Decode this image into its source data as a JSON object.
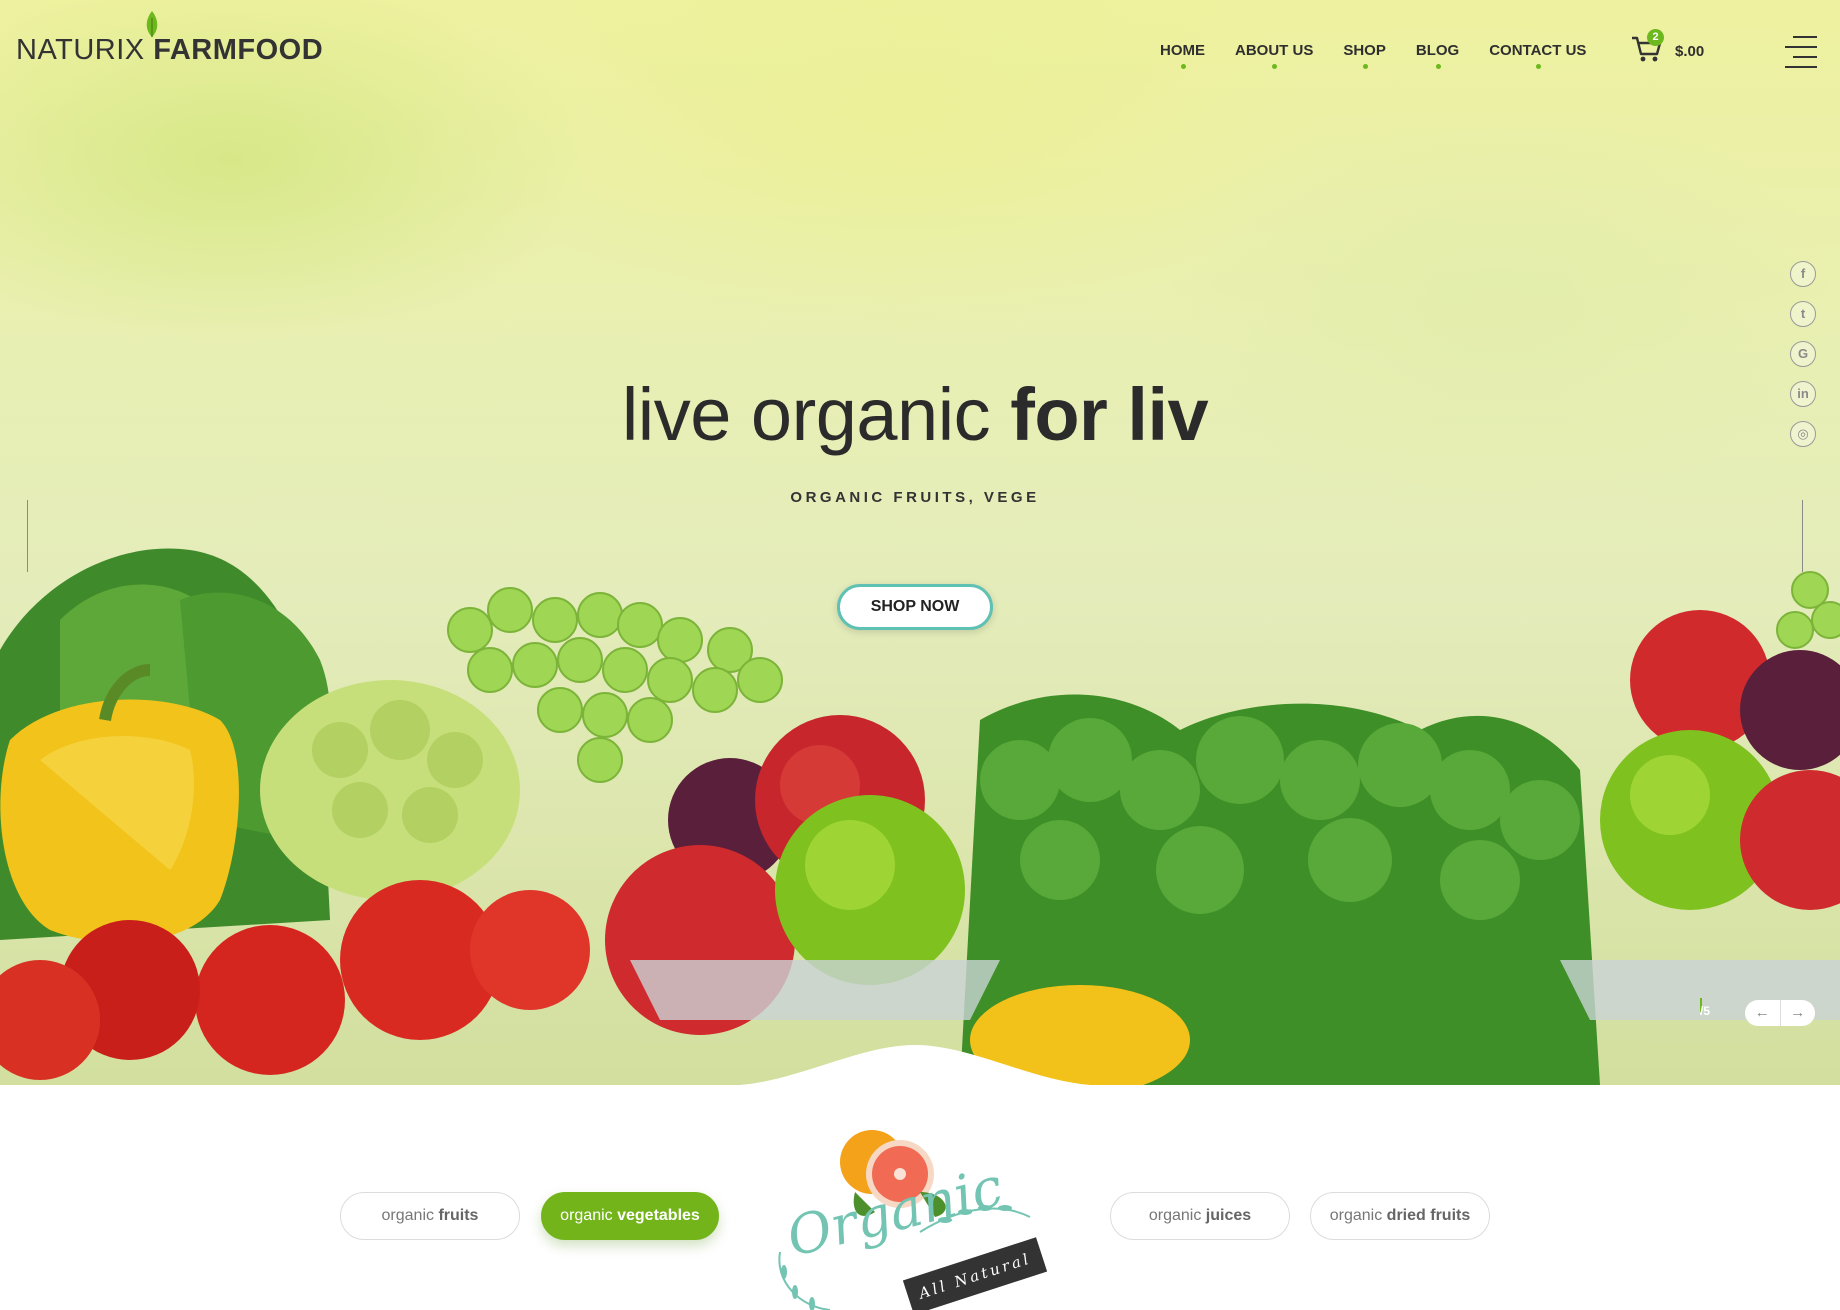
{
  "logo": {
    "light": "NATURIX",
    "bold": "FARMFOOD"
  },
  "nav": {
    "items": [
      {
        "label": "HOME"
      },
      {
        "label": "ABOUT US"
      },
      {
        "label": "SHOP"
      },
      {
        "label": "BLOG"
      },
      {
        "label": "CONTACT US"
      }
    ]
  },
  "cart": {
    "count": "2",
    "total": "$.00"
  },
  "social": [
    "facebook-icon",
    "twitter-icon",
    "google-icon",
    "linkedin-icon",
    "instagram-icon"
  ],
  "hero": {
    "title_light": "live organic ",
    "title_bold": "for liv",
    "subtitle": "ORGANIC FRUITS, VEGE",
    "cta": "SHOP NOW",
    "pager": "/5",
    "prev": "←",
    "next": "→"
  },
  "categories": [
    {
      "light": "organic ",
      "bold": "fruits",
      "active": false
    },
    {
      "light": "organic ",
      "bold": "vegetables",
      "active": true
    },
    {
      "light": "organic ",
      "bold": "juices",
      "active": false
    },
    {
      "light": "organic ",
      "bold": "dried fruits",
      "active": false
    }
  ],
  "badge": {
    "script": "Organic",
    "ribbon": "All Natural"
  },
  "colors": {
    "accent": "#6cb81e",
    "button_border": "#5ec1b3",
    "badge_green": "#73c4b2"
  }
}
